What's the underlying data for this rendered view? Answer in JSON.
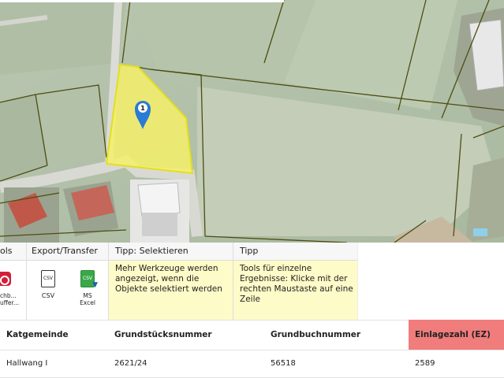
{
  "map": {
    "marker_number": "1"
  },
  "toolbar": {
    "tools_label": "ols",
    "tool_partial_1": "chb...",
    "tool_partial_2": "uffer...",
    "export_label": "Export/Transfer",
    "csv_icon_text": "CSV",
    "csv_label": "CSV",
    "excel_icon_text": "CSV",
    "excel_label_line1": "MS",
    "excel_label_line2": "Excel",
    "tip1_title": "Tipp: Selektieren",
    "tip1_text": "Mehr Werkzeuge werden angezeigt, wenn die Objekte selektiert werden",
    "tip2_title": "Tipp",
    "tip2_text": "Tools für einzelne Ergebnisse: Klicke mit der rechten Maustaste auf eine Zeile"
  },
  "table": {
    "columns": [
      "Katgemeinde",
      "Grundstücksnummer",
      "Grundbuchnummer",
      "Einlagezahl (EZ)"
    ],
    "rows": [
      [
        "Hallwang I",
        "2621/24",
        "56518",
        "2589"
      ]
    ]
  },
  "colors": {
    "highlight_column": "#f07c7c",
    "tip_background": "#fdfbc8",
    "parcel_fill": "#f4f06a",
    "marker": "#2a7bd4"
  }
}
